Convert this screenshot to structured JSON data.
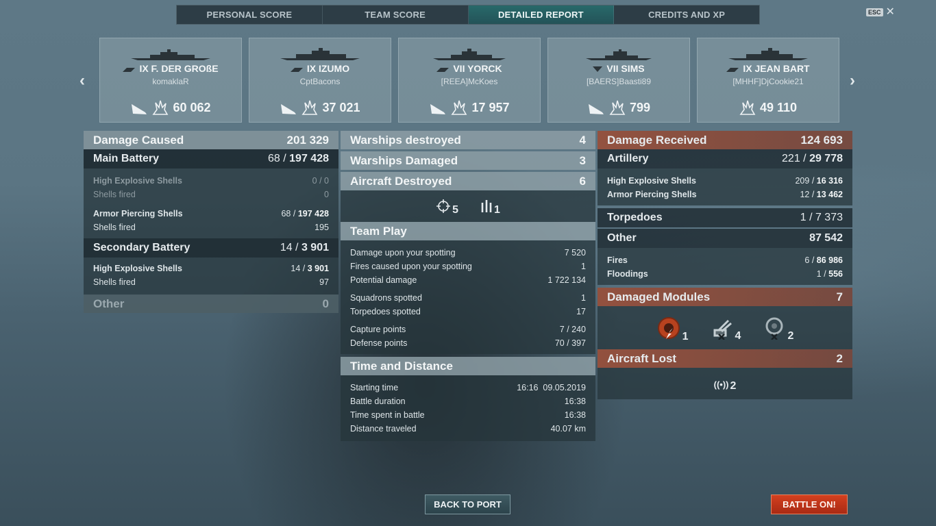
{
  "tabs": [
    {
      "label": "PERSONAL SCORE"
    },
    {
      "label": "TEAM SCORE"
    },
    {
      "label": "DETAILED REPORT"
    },
    {
      "label": "CREDITS AND XP"
    }
  ],
  "esc_label": "ESC",
  "cards": [
    {
      "tier_name": "IX F. DER GROßE",
      "player": "komaklaR",
      "damage": "60 062"
    },
    {
      "tier_name": "IX IZUMO",
      "player": "CptBacons",
      "damage": "37 021"
    },
    {
      "tier_name": "VII YORCK",
      "player": "[REEA]McKoes",
      "damage": "17 957"
    },
    {
      "tier_name": "VII SIMS",
      "player": "[BAERS]Baasti89",
      "damage": "799"
    },
    {
      "tier_name": "IX JEAN BART",
      "player": "[MHHF]DjCookie21",
      "damage": "49 110"
    }
  ],
  "damage_caused": {
    "title": "Damage Caused",
    "total": "201 329",
    "main_battery": {
      "label": "Main Battery",
      "hits": "68",
      "damage": "197 428"
    },
    "he_main": {
      "label": "High Explosive Shells",
      "value": "0 / 0"
    },
    "he_main_fired": {
      "label": "Shells fired",
      "value": "0"
    },
    "ap_main": {
      "label": "Armor Piercing Shells",
      "hits": "68",
      "damage": "197 428"
    },
    "ap_main_fired": {
      "label": "Shells fired",
      "value": "195"
    },
    "secondary": {
      "label": "Secondary Battery",
      "hits": "14",
      "damage": "3 901"
    },
    "he_sec": {
      "label": "High Explosive Shells",
      "hits": "14",
      "damage": "3 901"
    },
    "he_sec_fired": {
      "label": "Shells fired",
      "value": "97"
    },
    "other": {
      "label": "Other",
      "value": "0"
    }
  },
  "middle": {
    "warships_destroyed": {
      "label": "Warships destroyed",
      "value": "4"
    },
    "warships_damaged": {
      "label": "Warships Damaged",
      "value": "3"
    },
    "aircraft_destroyed": {
      "label": "Aircraft Destroyed",
      "value": "6"
    },
    "aircraft_icons": {
      "crosshair": "5",
      "fighter": "1"
    },
    "team_play": {
      "title": "Team Play",
      "damage_spotting": {
        "label": "Damage upon your spotting",
        "value": "7 520"
      },
      "fires_spotting": {
        "label": "Fires caused upon your spotting",
        "value": "1"
      },
      "potential": {
        "label": "Potential damage",
        "value": "1 722 134"
      },
      "squadrons": {
        "label": "Squadrons spotted",
        "value": "1"
      },
      "torpedoes": {
        "label": "Torpedoes spotted",
        "value": "17"
      },
      "capture": {
        "label": "Capture points",
        "value": "7 / 240"
      },
      "defense": {
        "label": "Defense points",
        "value": "70 / 397"
      }
    },
    "time_distance": {
      "title": "Time and Distance",
      "start": {
        "label": "Starting time",
        "value": "16:16  09.05.2019"
      },
      "duration": {
        "label": "Battle duration",
        "value": "16:38"
      },
      "spent": {
        "label": "Time spent in battle",
        "value": "16:38"
      },
      "distance": {
        "label": "Distance traveled",
        "value": "40.07 km"
      }
    }
  },
  "damage_received": {
    "title": "Damage Received",
    "total": "124 693",
    "artillery": {
      "label": "Artillery",
      "hits": "221",
      "damage": "29 778"
    },
    "he": {
      "label": "High Explosive Shells",
      "hits": "209",
      "damage": "16 316"
    },
    "ap": {
      "label": "Armor Piercing Shells",
      "hits": "12",
      "damage": "13 462"
    },
    "torpedoes": {
      "label": "Torpedoes",
      "value": "1 / 7 373"
    },
    "other": {
      "label": "Other",
      "value": "87 542"
    },
    "fires": {
      "label": "Fires",
      "hits": "6",
      "damage": "86 986"
    },
    "floodings": {
      "label": "Floodings",
      "hits": "1",
      "damage": "556"
    },
    "modules": {
      "title": "Damaged Modules",
      "value": "7",
      "engine": "1",
      "guns": "4",
      "steering": "2"
    },
    "aircraft_lost": {
      "title": "Aircraft Lost",
      "value": "2",
      "spotter": "2"
    }
  },
  "buttons": {
    "back": "BACK TO PORT",
    "battle": "BATTLE ON!"
  }
}
